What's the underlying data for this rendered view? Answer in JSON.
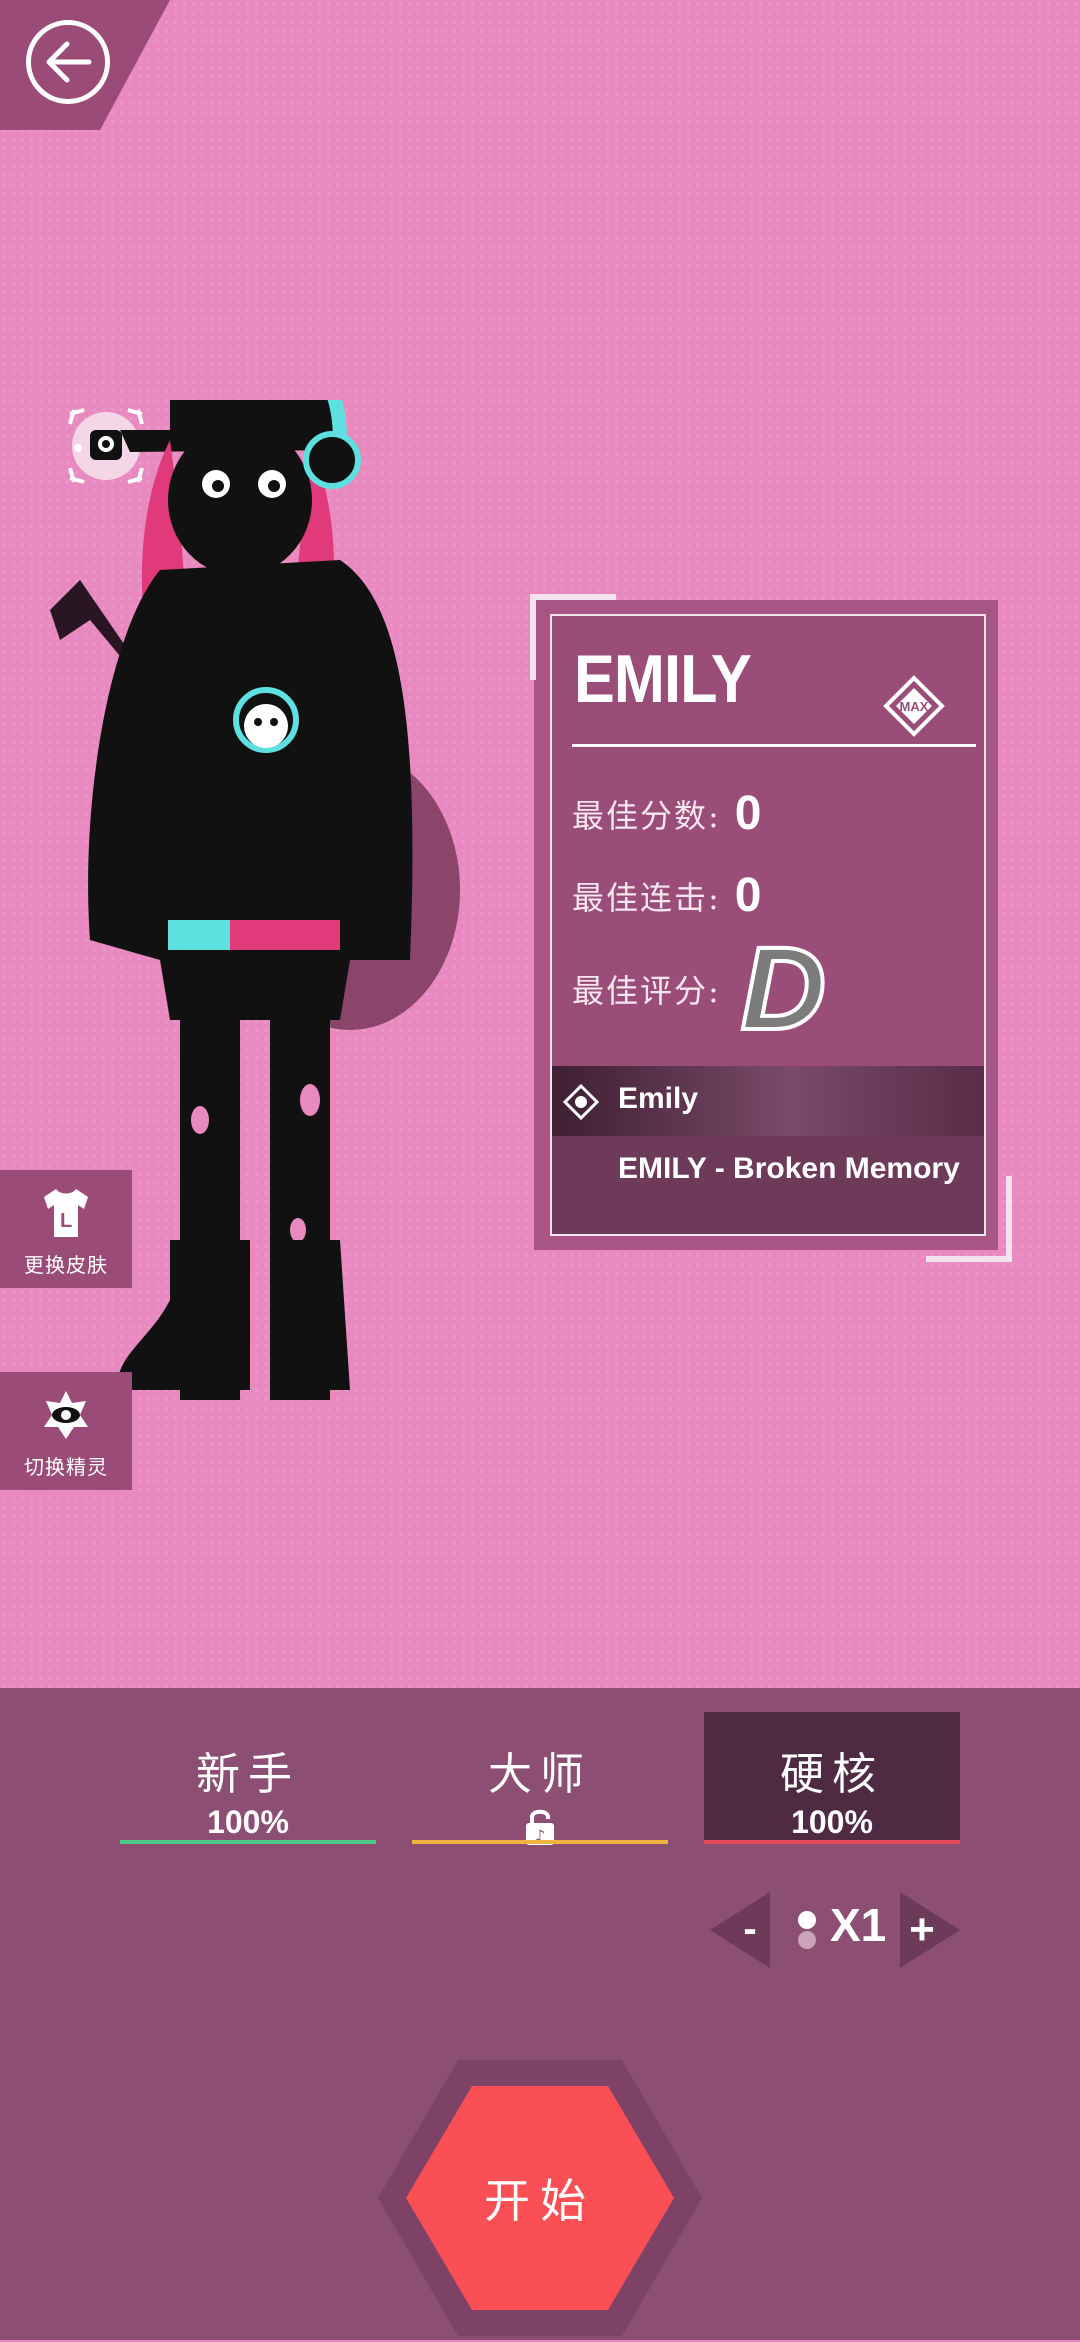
{
  "back": {
    "icon": "back-arrow-icon"
  },
  "character": {
    "name": "EMILY",
    "max_badge": "MAX",
    "stats": {
      "best_score_label": "最佳分数:",
      "best_score_value": "0",
      "best_combo_label": "最佳连击:",
      "best_combo_value": "0",
      "best_rank_label": "最佳评分:",
      "best_rank_value": "D"
    },
    "songs": [
      {
        "title": "Emily",
        "selected": true
      },
      {
        "title": "EMILY - Broken Memory",
        "selected": false
      }
    ]
  },
  "side_buttons": {
    "change_skin": {
      "label": "更换皮肤",
      "icon": "tshirt-icon"
    },
    "switch_sprite": {
      "label": "切换精灵",
      "icon": "eye-icon"
    }
  },
  "difficulties": [
    {
      "name": "新手",
      "progress": "100%",
      "line_color": "#4fc98a",
      "active": false
    },
    {
      "name": "大师",
      "progress": "",
      "locked": true,
      "line_color": "#f2b441",
      "active": false
    },
    {
      "name": "硬核",
      "progress": "100%",
      "line_color": "#e8485e",
      "active": true
    }
  ],
  "speed": {
    "minus": "-",
    "value": "X1",
    "plus": "+"
  },
  "start_button": {
    "label": "开始",
    "color": "#f94f55"
  },
  "colors": {
    "background": "#e889bf",
    "panel": "#9a4d78",
    "bottom": "#8c4f73"
  }
}
